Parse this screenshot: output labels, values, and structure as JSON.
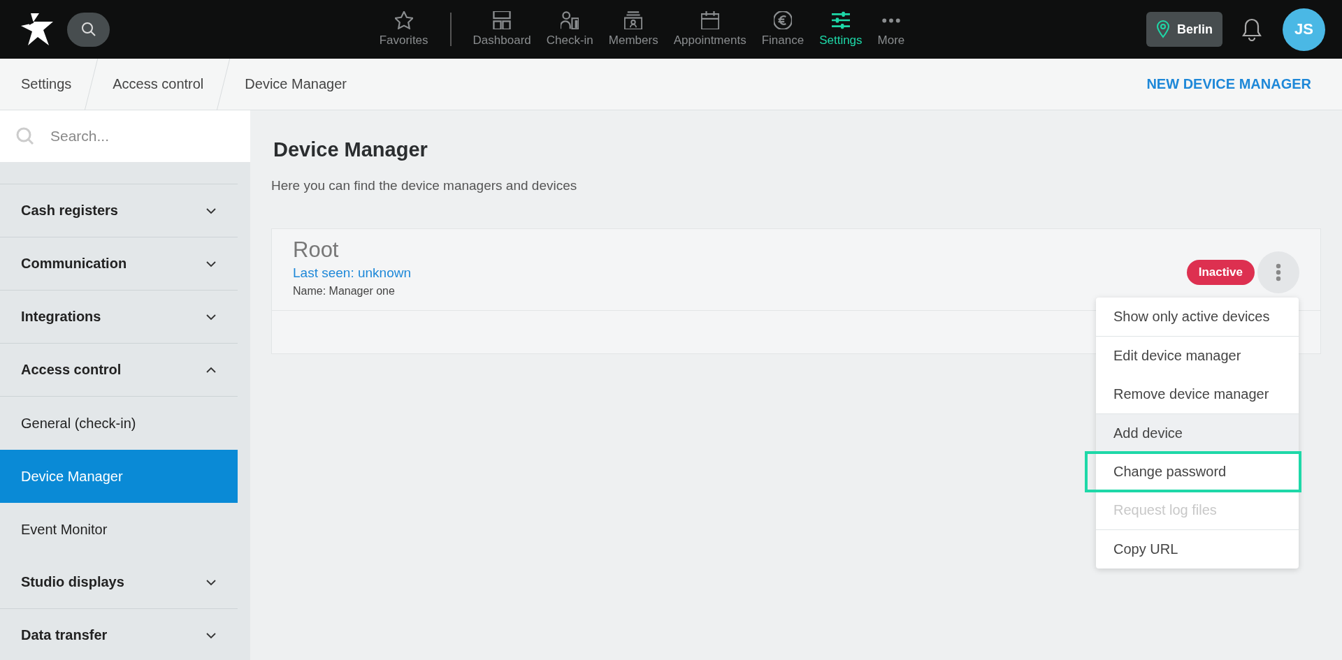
{
  "topbar": {
    "nav": [
      {
        "label": "Favorites",
        "selected": false,
        "divider_after": true
      },
      {
        "label": "Dashboard",
        "selected": false,
        "divider_after": false
      },
      {
        "label": "Check-in",
        "selected": false,
        "divider_after": false
      },
      {
        "label": "Members",
        "selected": false,
        "divider_after": false
      },
      {
        "label": "Appointments",
        "selected": false,
        "divider_after": false
      },
      {
        "label": "Finance",
        "selected": false,
        "divider_after": false
      },
      {
        "label": "Settings",
        "selected": true,
        "divider_after": false
      },
      {
        "label": "More",
        "selected": false,
        "divider_after": false
      }
    ],
    "location": "Berlin",
    "avatar": "JS"
  },
  "breadcrumbs": [
    "Settings",
    "Access control",
    "Device Manager"
  ],
  "action": "NEW DEVICE MANAGER",
  "sidebar": {
    "search": {
      "placeholder": "Search..."
    },
    "items": [
      {
        "label": "Cash registers",
        "expanded": false
      },
      {
        "label": "Communication",
        "expanded": false
      },
      {
        "label": "Integrations",
        "expanded": false
      },
      {
        "label": "Access control",
        "expanded": true,
        "children": [
          {
            "label": "General (check-in)",
            "selected": false
          },
          {
            "label": "Device Manager",
            "selected": true
          },
          {
            "label": "Event Monitor",
            "selected": false
          }
        ]
      },
      {
        "label": "Studio displays",
        "expanded": false
      },
      {
        "label": "Data transfer",
        "expanded": false
      }
    ]
  },
  "page": {
    "title": "Device Manager",
    "subtitle": "Here you can find the device managers and devices"
  },
  "card": {
    "name": "Root",
    "last_seen": "Last seen: unknown",
    "detail": "Name: Manager one",
    "status": "Inactive"
  },
  "menu": [
    {
      "label": "Show only active devices",
      "divider_before": false,
      "hovered": false,
      "disabled": false,
      "highlighted": false
    },
    {
      "label": "Edit device manager",
      "divider_before": true,
      "hovered": false,
      "disabled": false,
      "highlighted": false
    },
    {
      "label": "Remove device manager",
      "divider_before": false,
      "hovered": false,
      "disabled": false,
      "highlighted": false
    },
    {
      "label": "Add device",
      "divider_before": true,
      "hovered": true,
      "disabled": false,
      "highlighted": false
    },
    {
      "label": "Change password",
      "divider_before": false,
      "hovered": false,
      "disabled": false,
      "highlighted": true
    },
    {
      "label": "Request log files",
      "divider_before": false,
      "hovered": false,
      "disabled": true,
      "highlighted": false
    },
    {
      "label": "Copy URL",
      "divider_before": true,
      "hovered": false,
      "disabled": false,
      "highlighted": false
    }
  ]
}
